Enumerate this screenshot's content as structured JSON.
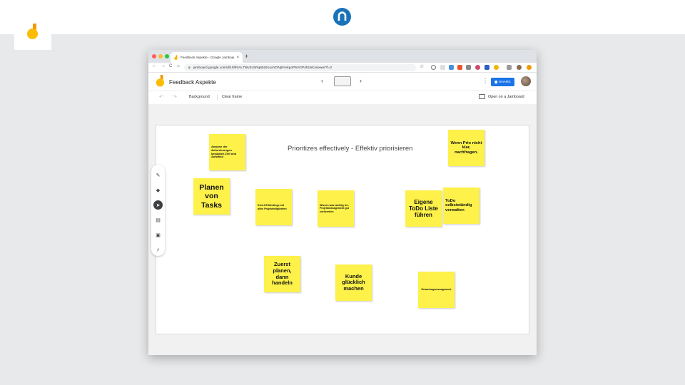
{
  "slide": {
    "brand_icon": "n-logo-icon",
    "brand_color": "#1a73b8",
    "corner_icon": "jamboard-icon"
  },
  "browser": {
    "tab_title": "Feedback Aspekte - Google Jamboard",
    "tab_close": "×",
    "new_tab": "+",
    "url": "jamboard.google.com/d/1rlhf0AL7WvZcSRq6bz61oaYDNj5YnkpoP5VGP4h19/c/viewer?f=2",
    "nav": {
      "back": "←",
      "forward": "→",
      "reload": "C",
      "home": "⌂"
    },
    "star": "☆"
  },
  "app": {
    "title": "Feedback Aspekte",
    "prev_frame": "‹",
    "next_frame": "›",
    "frame_thumb": "",
    "share_label": "SHARE",
    "kebab": "⋮"
  },
  "toolbar": {
    "undo": "↶",
    "redo": "↷",
    "background": "Background",
    "clear_frame": "Clear frame",
    "open_on_jamboard": "Open on a Jamboard"
  },
  "canvas": {
    "frame_title": "Prioritizes effectively - Effektiv priorisieren",
    "notes": [
      {
        "id": "analyse",
        "text": "Analyse der Anforderungen bezüglich Zeit und Aufwand"
      },
      {
        "id": "wenn-prio",
        "text": "Wenn Prio nicht klar, nachfragen."
      },
      {
        "id": "planen-tasks",
        "text": "Planen von Tasks"
      },
      {
        "id": "kickoff",
        "text": "Kick-Off Meetings mit allen Projektmitgliedern"
      },
      {
        "id": "wissen",
        "text": "Wissen was wichtig ist - Projektmanagement gut vorbereiten"
      },
      {
        "id": "eigene-todo",
        "text": "Eigene ToDo Liste führen"
      },
      {
        "id": "todo-selbst",
        "text": "ToDo selbstständig verwalten"
      },
      {
        "id": "zuerst-planen",
        "text": "Zuerst planen, dann handeln"
      },
      {
        "id": "kunde",
        "text": "Kunde glücklich machen"
      },
      {
        "id": "erwartung",
        "text": "Erwartungsmanagement"
      }
    ]
  },
  "colors": {
    "sticky": "#fdf14a",
    "share": "#1a73e8",
    "active_tool": "#3c4043"
  }
}
